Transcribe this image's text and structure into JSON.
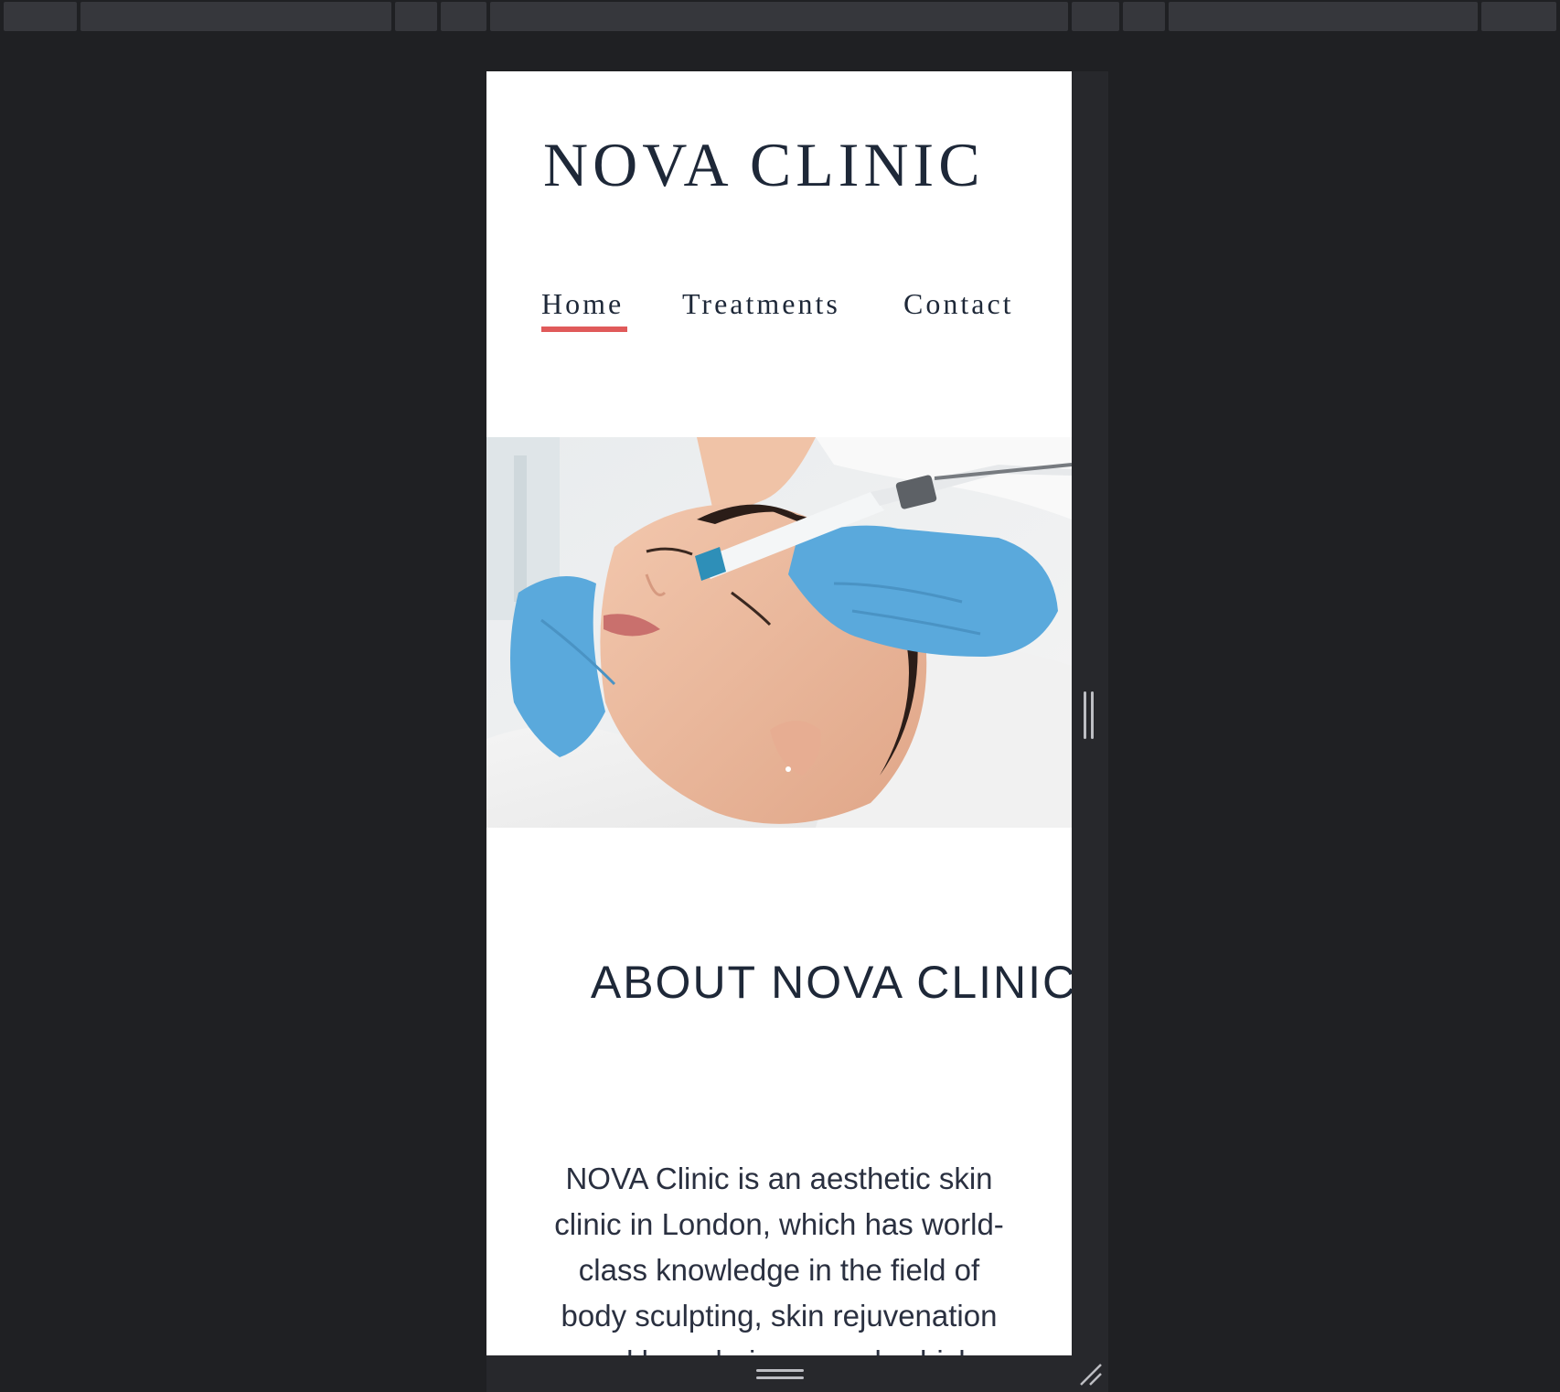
{
  "site": {
    "logo": "NOVA CLINIC"
  },
  "nav": {
    "items": [
      {
        "label": "Home",
        "active": true
      },
      {
        "label": "Treatments",
        "active": false
      },
      {
        "label": "Contact",
        "active": false
      }
    ]
  },
  "about": {
    "title": "ABOUT NOVA CLINIC",
    "body": "NOVA Clinic is an aesthetic skin clinic in London, which has world-class knowledge in the field of body sculpting, skin rejuvenation and laser hair removal, which"
  },
  "colors": {
    "accent": "#e05a5a",
    "text": "#1e2838",
    "glove": "#5aa9dc",
    "background": "#1f2023"
  },
  "icons": {
    "resize_handle_right": "drag-handle-vertical-icon",
    "resize_handle_bottom": "drag-handle-horizontal-icon",
    "resize_corner": "resize-corner-icon"
  }
}
